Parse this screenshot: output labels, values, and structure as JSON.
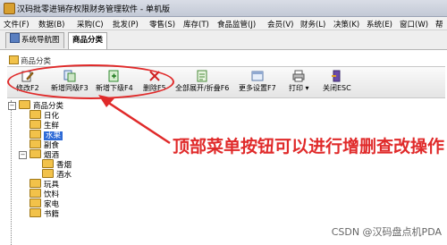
{
  "window": {
    "title": "汉码批零进销存权限财务管理软件 - 单机版"
  },
  "menu": [
    "文件(F)",
    "数据(B)",
    "采购(C)",
    "批发(P)",
    "零售(S)",
    "库存(T)",
    "食品监管(J)",
    "会员(V)",
    "财务(L)",
    "决策(K)",
    "系统(E)",
    "窗口(W)",
    "帮"
  ],
  "tabs": [
    {
      "label": "系统导航图",
      "active": false
    },
    {
      "label": "商品分类",
      "active": true
    }
  ],
  "panel": {
    "title": "商品分类"
  },
  "toolbar": {
    "buttons": [
      {
        "label": "修改F2",
        "icon": "edit-icon"
      },
      {
        "label": "新增同级F3",
        "icon": "add-sibling-icon"
      },
      {
        "label": "新增下级F4",
        "icon": "add-child-icon"
      },
      {
        "label": "删除F5",
        "icon": "delete-icon"
      },
      {
        "label": "全部展开/折叠F6",
        "icon": "expand-collapse-icon"
      },
      {
        "label": "更多设置F7",
        "icon": "more-settings-icon"
      },
      {
        "label": "打印",
        "icon": "print-icon"
      },
      {
        "label": "关闭ESC",
        "icon": "close-icon"
      }
    ]
  },
  "tree": {
    "root": "商品分类",
    "items": [
      {
        "label": "日化",
        "level": 1
      },
      {
        "label": "生鲜",
        "level": 1
      },
      {
        "label": "水果",
        "level": 1,
        "selected": true
      },
      {
        "label": "副食",
        "level": 1
      },
      {
        "label": "烟酒",
        "level": 1
      },
      {
        "label": "香烟",
        "level": 2
      },
      {
        "label": "酒水",
        "level": 2
      },
      {
        "label": "玩具",
        "level": 1
      },
      {
        "label": "饮料",
        "level": 1
      },
      {
        "label": "家电",
        "level": 1
      },
      {
        "label": "书籍",
        "level": 1
      }
    ]
  },
  "annotation": "顶部菜单按钮可以进行增删查改操作",
  "watermark": "CSDN @汉码盘点机PDA",
  "colors": {
    "highlight": "#e02a2a",
    "selection": "#2f6bd6"
  }
}
